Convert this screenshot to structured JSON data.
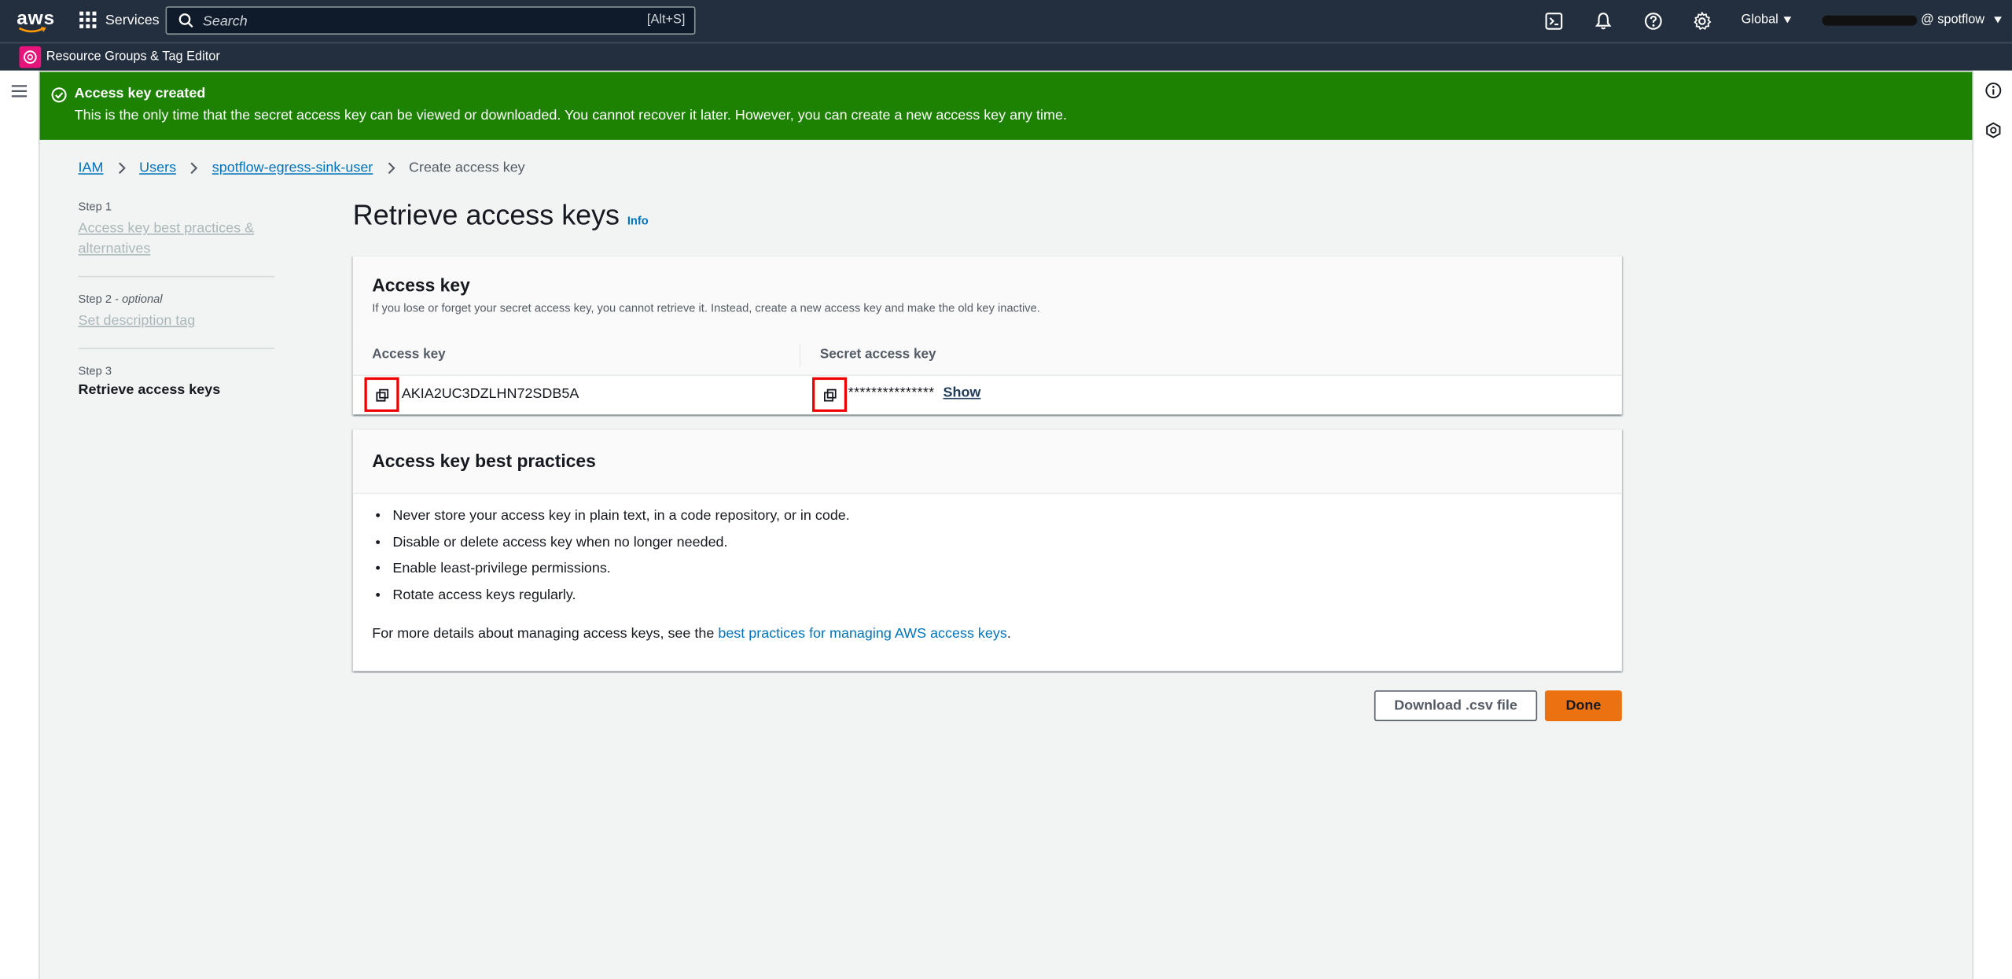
{
  "topnav": {
    "logo": "aws",
    "services_label": "Services",
    "search_placeholder": "Search",
    "search_hint": "[Alt+S]",
    "region_label": "Global",
    "account_suffix": "@ spotflow",
    "icons": [
      "cloudshell-icon",
      "notifications-icon",
      "help-icon",
      "settings-icon"
    ]
  },
  "subnav": {
    "service_label": "Resource Groups & Tag Editor"
  },
  "flash": {
    "title": "Access key created",
    "message": "This is the only time that the secret access key can be viewed or downloaded. You cannot recover it later. However, you can create a new access key any time."
  },
  "breadcrumb": {
    "items": [
      "IAM",
      "Users",
      "spotflow-egress-sink-user"
    ],
    "current": "Create access key"
  },
  "steps": [
    {
      "num": "Step 1",
      "optional": "",
      "label": "Access key best practices & alternatives"
    },
    {
      "num": "Step 2",
      "optional": "optional",
      "label": "Set description tag"
    },
    {
      "num": "Step 3",
      "optional": "",
      "label": "Retrieve access keys"
    }
  ],
  "page": {
    "title": "Retrieve access keys",
    "info": "Info"
  },
  "access_key_panel": {
    "title": "Access key",
    "description": "If you lose or forget your secret access key, you cannot retrieve it. Instead, create a new access key and make the old key inactive.",
    "col_access_key": "Access key",
    "col_secret": "Secret access key",
    "access_key_value": "AKIA2UC3DZLHN72SDB5A",
    "secret_masked": "***************",
    "show_label": "Show"
  },
  "best_practices_panel": {
    "title": "Access key best practices",
    "items": [
      "Never store your access key in plain text, in a code repository, or in code.",
      "Disable or delete access key when no longer needed.",
      "Enable least-privilege permissions.",
      "Rotate access keys regularly."
    ],
    "more_prefix": "For more details about managing access keys, see the ",
    "more_link": "best practices for managing AWS access keys",
    "more_suffix": "."
  },
  "actions": {
    "download_label": "Download .csv file",
    "done_label": "Done"
  },
  "colors": {
    "nav_bg": "#232f3e",
    "flash_success": "#1d8102",
    "primary_button": "#ec7211",
    "link": "#0073bb",
    "highlight_box": "#ee0000"
  }
}
